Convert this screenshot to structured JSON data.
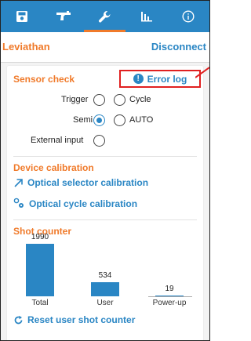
{
  "tabs": [
    {
      "name": "save",
      "icon": "save-icon"
    },
    {
      "name": "gun",
      "icon": "gun-icon"
    },
    {
      "name": "tools",
      "icon": "wrench-icon",
      "active": true
    },
    {
      "name": "stats",
      "icon": "bar-chart-icon"
    },
    {
      "name": "info",
      "icon": "info-icon"
    }
  ],
  "header": {
    "device_name": "Leviathan",
    "disconnect_label": "Disconnect"
  },
  "sensor_check": {
    "title": "Sensor check",
    "error_log_label": "Error log",
    "trigger_label": "Trigger",
    "cycle_label": "Cycle",
    "semi_label": "Semi",
    "auto_label": "AUTO",
    "external_input_label": "External input",
    "semi_selected": true
  },
  "device_calibration": {
    "title": "Device calibration",
    "optical_selector_label": "Optical selector calibration",
    "optical_cycle_label": "Optical cycle calibration"
  },
  "shot_counter": {
    "title": "Shot counter",
    "reset_label": "Reset user shot counter"
  },
  "chart_data": {
    "type": "bar",
    "categories": [
      "Total",
      "User",
      "Power-up"
    ],
    "values": [
      1990,
      534,
      19
    ],
    "ylim": [
      0,
      1990
    ]
  },
  "colors": {
    "primary": "#2a86c4",
    "accent": "#f07a2a",
    "highlight": "#e02020"
  }
}
